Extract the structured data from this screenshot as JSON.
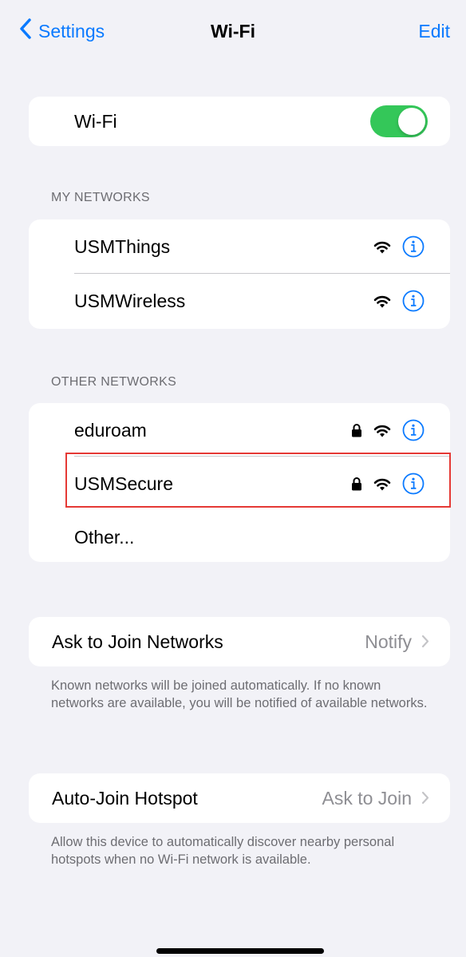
{
  "nav": {
    "back_label": "Settings",
    "title": "Wi-Fi",
    "edit_label": "Edit"
  },
  "wifi": {
    "label": "Wi-Fi",
    "enabled": true
  },
  "my_networks": {
    "header": "MY NETWORKS",
    "items": [
      {
        "name": "USMThings",
        "locked": false
      },
      {
        "name": "USMWireless",
        "locked": false
      }
    ]
  },
  "other_networks": {
    "header": "OTHER NETWORKS",
    "items": [
      {
        "name": "eduroam",
        "locked": true
      },
      {
        "name": "USMSecure",
        "locked": true,
        "highlighted": true
      }
    ],
    "other_label": "Other..."
  },
  "ask_to_join": {
    "label": "Ask to Join Networks",
    "value": "Notify",
    "footnote": "Known networks will be joined automatically. If no known networks are available, you will be notified of available networks."
  },
  "auto_join": {
    "label": "Auto-Join Hotspot",
    "value": "Ask to Join",
    "footnote": "Allow this device to automatically discover nearby personal hotspots when no Wi-Fi network is available."
  },
  "colors": {
    "accent": "#0a7aff",
    "toggle_on": "#34c759",
    "background": "#f2f2f7",
    "highlight": "#e53935"
  }
}
